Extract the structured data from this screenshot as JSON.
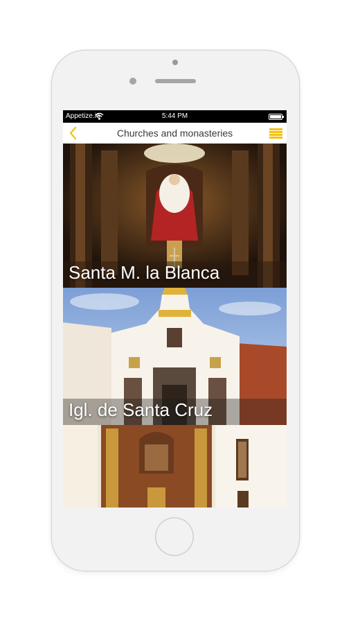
{
  "status_bar": {
    "carrier": "Appetize.io",
    "time": "5:44 PM"
  },
  "nav": {
    "title": "Churches and monasteries",
    "back_icon": "chevron-left-icon",
    "menu_icon": "hamburger-menu-icon"
  },
  "colors": {
    "accent": "#f4c20d"
  },
  "items": [
    {
      "label": "Santa M. la Blanca"
    },
    {
      "label": "Igl. de Santa Cruz"
    },
    {
      "label": ""
    }
  ]
}
